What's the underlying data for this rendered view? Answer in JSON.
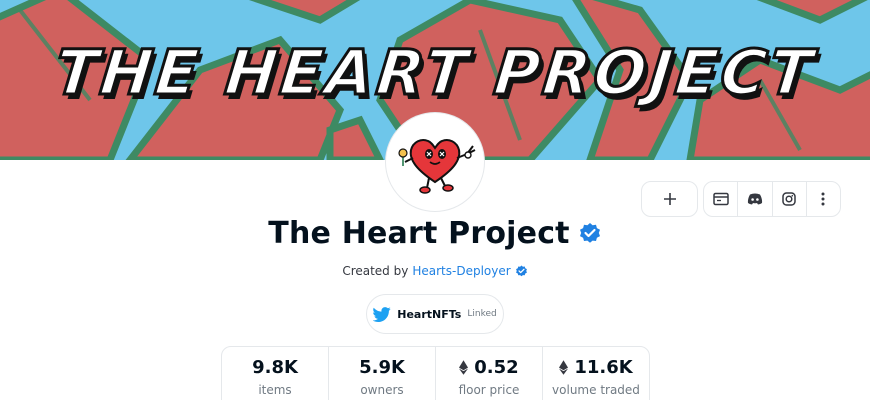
{
  "banner": {
    "title": "THE HEART PROJECT"
  },
  "collection": {
    "name": "The Heart Project",
    "created_by_label": "Created by",
    "creator": "Hearts-Deployer"
  },
  "twitter": {
    "handle": "HeartNFTs",
    "status": "Linked"
  },
  "actions": {
    "icons": [
      "plus-icon",
      "website-icon",
      "discord-icon",
      "instagram-icon",
      "more-icon"
    ]
  },
  "stats": [
    {
      "value": "9.8K",
      "label": "items",
      "eth": false
    },
    {
      "value": "5.9K",
      "label": "owners",
      "eth": false
    },
    {
      "value": "0.52",
      "label": "floor price",
      "eth": true
    },
    {
      "value": "11.6K",
      "label": "volume traded",
      "eth": true
    }
  ],
  "colors": {
    "verified": "#2081e2",
    "twitter": "#1da1f2",
    "banner_red": "#d0615e",
    "banner_blue": "#6ec6ea"
  }
}
